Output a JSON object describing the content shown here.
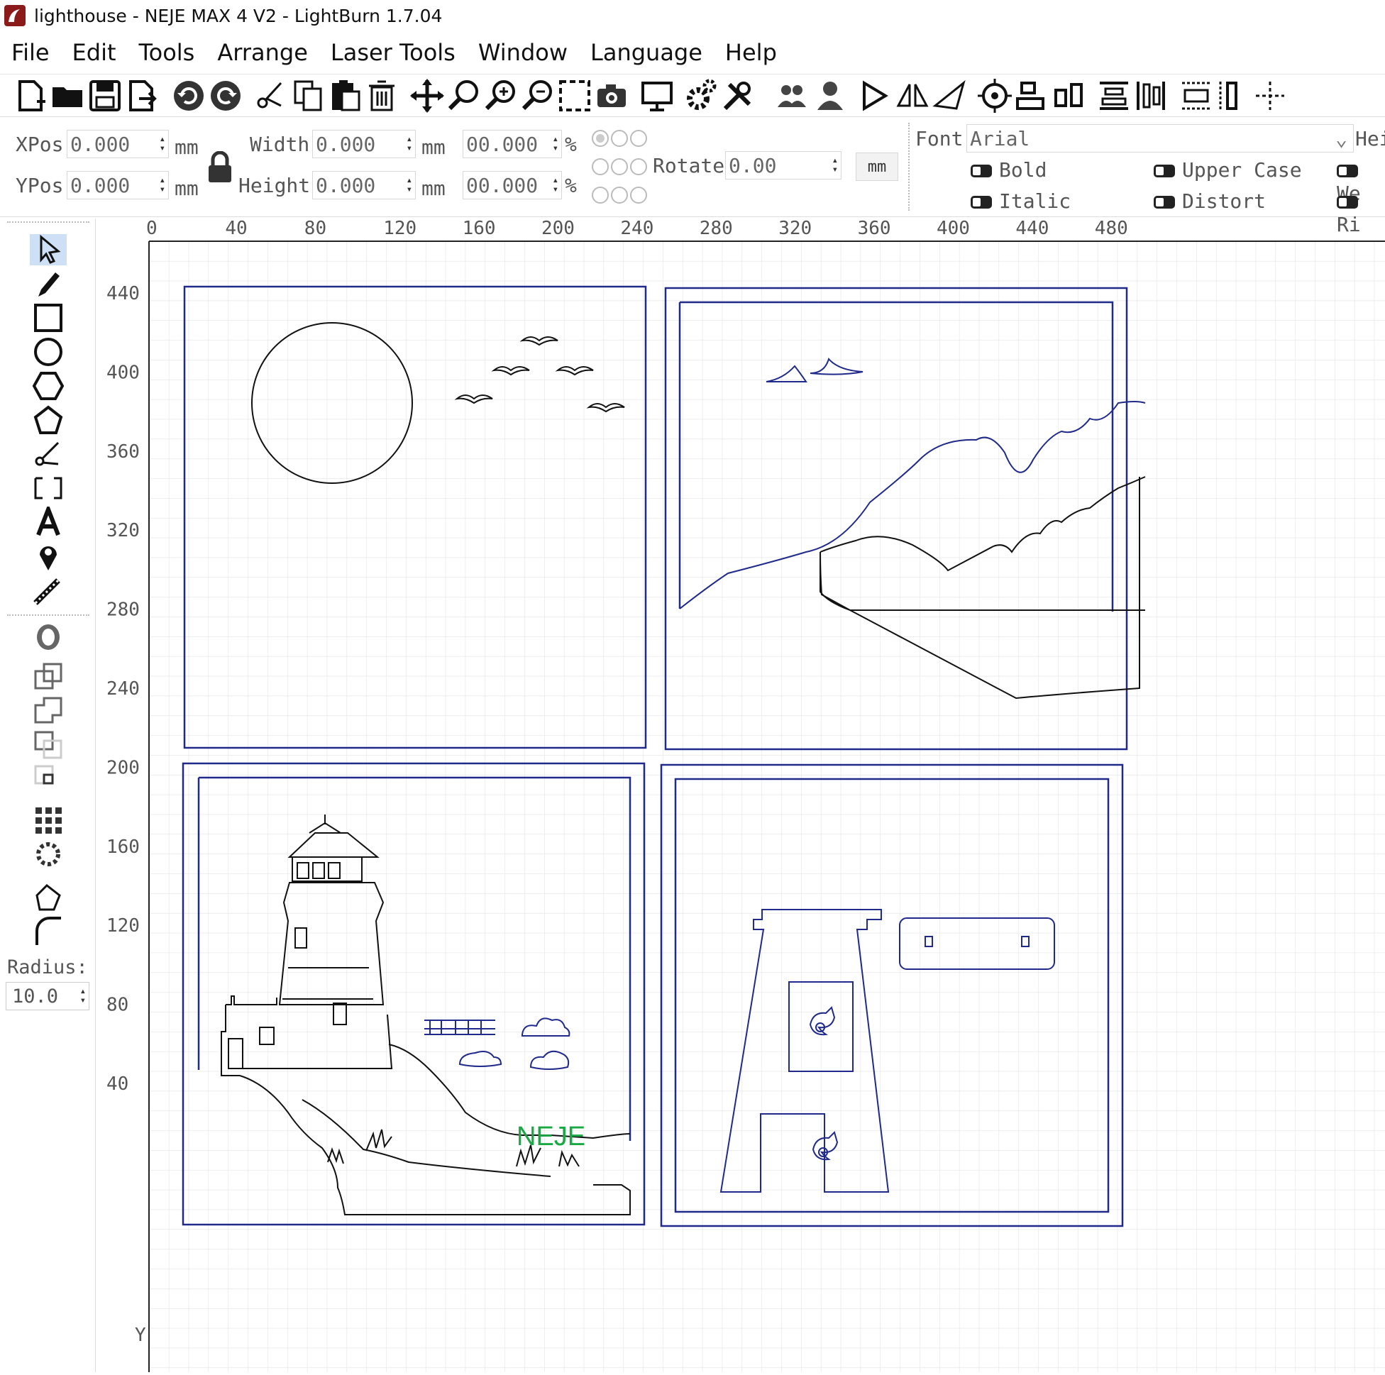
{
  "window": {
    "title": "lighthouse   - NEJE MAX 4 V2 - LightBurn 1.7.04"
  },
  "menu": [
    "File",
    "Edit",
    "Tools",
    "Arrange",
    "Laser Tools",
    "Window",
    "Language",
    "Help"
  ],
  "toolbar_icons": [
    "new-file-icon",
    "open-folder-icon",
    "save-icon",
    "export-icon",
    "undo-icon",
    "redo-icon",
    "cut-icon",
    "copy-icon",
    "paste-icon",
    "delete-icon",
    "move-icon",
    "zoom-fit-icon",
    "zoom-in-icon",
    "zoom-out-icon",
    "zoom-frame-icon",
    "camera-icon",
    "monitor-icon",
    "settings-icon",
    "tools-icon",
    "users-icon",
    "user-icon",
    "mirror-icon",
    "flip-icon",
    "send-icon",
    "target-icon",
    "align-left-icon",
    "align-center-icon",
    "distribute-icon",
    "distribute-v-icon",
    "layout-icon",
    "dock-icon",
    "position-icon"
  ],
  "props": {
    "xpos_label": "XPos",
    "xpos_value": "0.000",
    "ypos_label": "YPos",
    "ypos_value": "0.000",
    "width_label": "Width",
    "width_value": "0.000",
    "height_label": "Height",
    "height_value": "0.000",
    "unit": "mm",
    "pct_x": "00.000",
    "pct_y": "00.000",
    "pct_sign": "%",
    "rotate_label": "Rotate",
    "rotate_value": "0.00",
    "mm_button": "mm",
    "font_label": "Font",
    "font_value": "Arial",
    "height_cut": "Hei",
    "bold": "Bold",
    "italic": "Italic",
    "upper_case": "Upper Case",
    "distort": "Distort",
    "we_cut": "We",
    "ri_cut": "Ri"
  },
  "left_tools": {
    "radius_label": "Radius:",
    "radius_value": "10.0"
  },
  "rulers": {
    "x_ticks": [
      "0",
      "40",
      "80",
      "120",
      "160",
      "200",
      "240",
      "280",
      "320",
      "360",
      "400",
      "440",
      "480"
    ],
    "y_ticks": [
      "440",
      "400",
      "360",
      "320",
      "280",
      "240",
      "200",
      "160",
      "120",
      "80",
      "40"
    ],
    "y_axis_letter": "Y"
  },
  "canvas": {
    "label_text": "NEJE",
    "shape_color": "#1f2a8a",
    "line_color": "#111111",
    "label_color": "#19a843"
  }
}
